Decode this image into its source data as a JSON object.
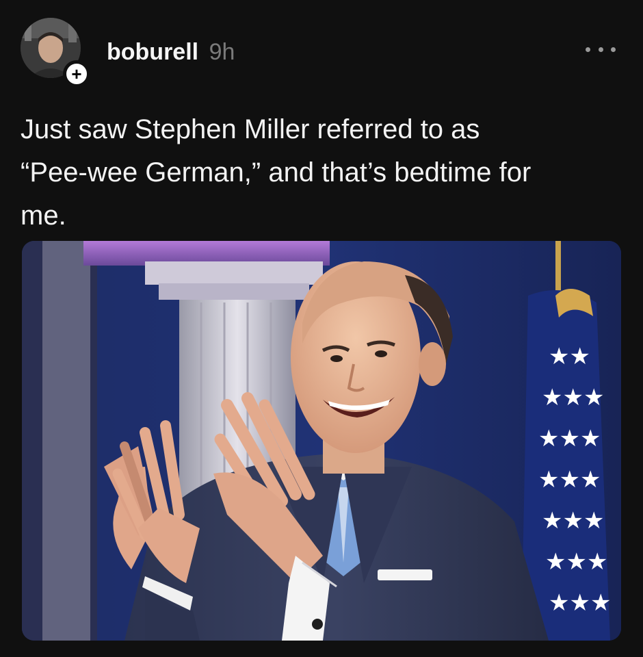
{
  "post": {
    "username": "boburell",
    "timestamp": "9h",
    "follow_symbol": "+",
    "text": "Just saw Stephen Miller referred to as\n“Pee-wee German,” and that’s bedtime for\nme."
  },
  "icons": {
    "avatar": "profile-photo",
    "follow": "plus-icon",
    "more": "ellipsis-icon"
  },
  "colors": {
    "background": "#101010",
    "text": "#f3f3f3",
    "timestamp": "#7a7a7a",
    "more_dots": "#9a9a9a"
  }
}
